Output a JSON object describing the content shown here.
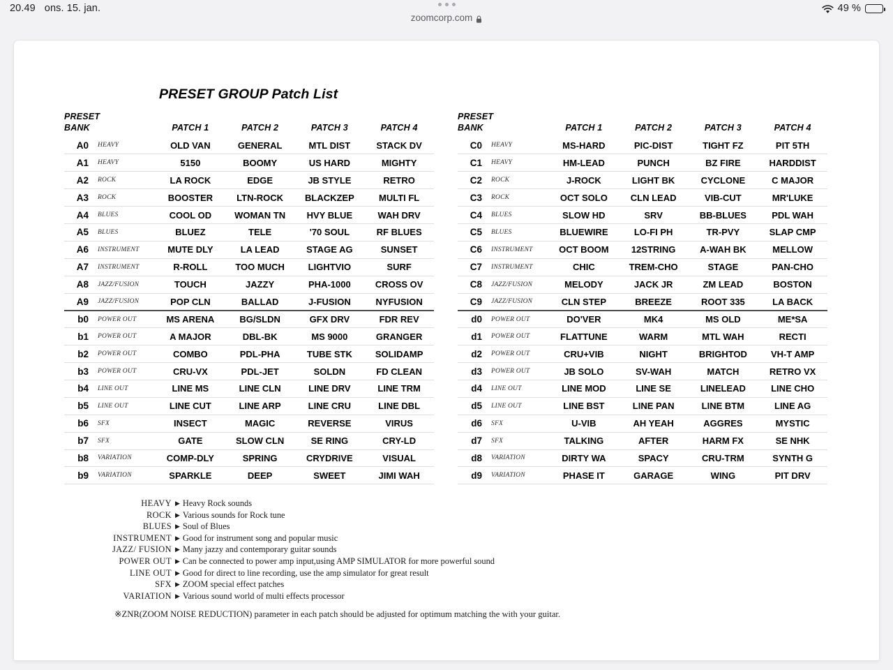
{
  "status_bar": {
    "time": "20.49",
    "date": "ons. 15. jan.",
    "battery_percent": "49 %",
    "wifi_icon": "wifi-icon",
    "battery_icon": "battery-icon",
    "battery_level": 49
  },
  "browser": {
    "url": "zoomcorp.com",
    "lock_icon": "lock-icon",
    "tabs_icon": "tab-overview-icon"
  },
  "document": {
    "title": "PRESET GROUP Patch List",
    "footnote": "※ZNR(ZOOM NOISE REDUCTION) parameter in each patch should be adjusted for optimum matching the with your guitar."
  },
  "tables": [
    {
      "id": "table-a-b",
      "header": {
        "preset": "PRESET",
        "bank": "BANK",
        "patches": [
          "PATCH 1",
          "PATCH 2",
          "PATCH 3",
          "PATCH 4"
        ]
      },
      "rows": [
        {
          "bank": "A0",
          "category": "HEAVY",
          "patches": [
            "OLD VAN",
            "GENERAL",
            "MTL DIST",
            "STACK DV"
          ]
        },
        {
          "bank": "A1",
          "category": "HEAVY",
          "patches": [
            "5150",
            "BOOMY",
            "US HARD",
            "MIGHTY"
          ]
        },
        {
          "bank": "A2",
          "category": "ROCK",
          "patches": [
            "LA ROCK",
            "EDGE",
            "JB STYLE",
            "RETRO"
          ]
        },
        {
          "bank": "A3",
          "category": "ROCK",
          "patches": [
            "BOOSTER",
            "LTN-ROCK",
            "BLACKZEP",
            "MULTI FL"
          ]
        },
        {
          "bank": "A4",
          "category": "BLUES",
          "patches": [
            "COOL OD",
            "WOMAN TN",
            "HVY BLUE",
            "WAH DRV"
          ]
        },
        {
          "bank": "A5",
          "category": "BLUES",
          "patches": [
            "BLUEZ",
            "TELE",
            "'70 SOUL",
            "RF BLUES"
          ]
        },
        {
          "bank": "A6",
          "category": "INSTRUMENT",
          "patches": [
            "MUTE DLY",
            "LA LEAD",
            "STAGE AG",
            "SUNSET"
          ]
        },
        {
          "bank": "A7",
          "category": "INSTRUMENT",
          "patches": [
            "R-ROLL",
            "TOO MUCH",
            "LIGHTVIO",
            "SURF"
          ]
        },
        {
          "bank": "A8",
          "category": "JAZZ/FUSION",
          "patches": [
            "TOUCH",
            "JAZZY",
            "PHA-1000",
            "CROSS OV"
          ]
        },
        {
          "bank": "A9",
          "category": "JAZZ/FUSION",
          "patches": [
            "POP CLN",
            "BALLAD",
            "J-FUSION",
            "NYFUSION"
          ],
          "divider": true
        },
        {
          "bank": "b0",
          "category": "POWER OUT",
          "patches": [
            "MS ARENA",
            "BG/SLDN",
            "GFX DRV",
            "FDR REV"
          ]
        },
        {
          "bank": "b1",
          "category": "POWER OUT",
          "patches": [
            "A MAJOR",
            "DBL-BK",
            "MS 9000",
            "GRANGER"
          ]
        },
        {
          "bank": "b2",
          "category": "POWER OUT",
          "patches": [
            "COMBO",
            "PDL-PHA",
            "TUBE STK",
            "SOLIDAMP"
          ]
        },
        {
          "bank": "b3",
          "category": "POWER OUT",
          "patches": [
            "CRU-VX",
            "PDL-JET",
            "SOLDN",
            "FD CLEAN"
          ]
        },
        {
          "bank": "b4",
          "category": "LINE OUT",
          "patches": [
            "LINE MS",
            "LINE CLN",
            "LINE DRV",
            "LINE TRM"
          ]
        },
        {
          "bank": "b5",
          "category": "LINE OUT",
          "patches": [
            "LINE CUT",
            "LINE ARP",
            "LINE CRU",
            "LINE DBL"
          ]
        },
        {
          "bank": "b6",
          "category": "SFX",
          "patches": [
            "INSECT",
            "MAGIC",
            "REVERSE",
            "VIRUS"
          ]
        },
        {
          "bank": "b7",
          "category": "SFX",
          "patches": [
            "GATE",
            "SLOW CLN",
            "SE RING",
            "CRY-LD"
          ]
        },
        {
          "bank": "b8",
          "category": "VARIATION",
          "patches": [
            "COMP-DLY",
            "SPRING",
            "CRYDRIVE",
            "VISUAL"
          ]
        },
        {
          "bank": "b9",
          "category": "VARIATION",
          "patches": [
            "SPARKLE",
            "DEEP",
            "SWEET",
            "JIMI WAH"
          ]
        }
      ]
    },
    {
      "id": "table-c-d",
      "header": {
        "preset": "PRESET",
        "bank": "BANK",
        "patches": [
          "PATCH 1",
          "PATCH 2",
          "PATCH 3",
          "PATCH 4"
        ]
      },
      "rows": [
        {
          "bank": "C0",
          "category": "HEAVY",
          "patches": [
            "MS-HARD",
            "PIC-DIST",
            "TIGHT FZ",
            "PIT 5TH"
          ]
        },
        {
          "bank": "C1",
          "category": "HEAVY",
          "patches": [
            "HM-LEAD",
            "PUNCH",
            "BZ FIRE",
            "HARDDIST"
          ]
        },
        {
          "bank": "C2",
          "category": "ROCK",
          "patches": [
            "J-ROCK",
            "LIGHT BK",
            "CYCLONE",
            "C MAJOR"
          ]
        },
        {
          "bank": "C3",
          "category": "ROCK",
          "patches": [
            "OCT SOLO",
            "CLN LEAD",
            "VIB-CUT",
            "MR'LUKE"
          ]
        },
        {
          "bank": "C4",
          "category": "BLUES",
          "patches": [
            "SLOW HD",
            "SRV",
            "BB-BLUES",
            "PDL WAH"
          ]
        },
        {
          "bank": "C5",
          "category": "BLUES",
          "patches": [
            "BLUEWIRE",
            "LO-FI PH",
            "TR-PVY",
            "SLAP CMP"
          ]
        },
        {
          "bank": "C6",
          "category": "INSTRUMENT",
          "patches": [
            "OCT BOOM",
            "12STRING",
            "A-WAH BK",
            "MELLOW"
          ]
        },
        {
          "bank": "C7",
          "category": "INSTRUMENT",
          "patches": [
            "CHIC",
            "TREM-CHO",
            "STAGE",
            "PAN-CHO"
          ]
        },
        {
          "bank": "C8",
          "category": "JAZZ/FUSION",
          "patches": [
            "MELODY",
            "JACK JR",
            "ZM LEAD",
            "BOSTON"
          ]
        },
        {
          "bank": "C9",
          "category": "JAZZ/FUSION",
          "patches": [
            "CLN STEP",
            "BREEZE",
            "ROOT 335",
            "LA BACK"
          ],
          "divider": true
        },
        {
          "bank": "d0",
          "category": "POWER OUT",
          "patches": [
            "DO'VER",
            "MK4",
            "MS OLD",
            "ME*SA"
          ]
        },
        {
          "bank": "d1",
          "category": "POWER OUT",
          "patches": [
            "FLATTUNE",
            "WARM",
            "MTL WAH",
            "RECTI"
          ]
        },
        {
          "bank": "d2",
          "category": "POWER OUT",
          "patches": [
            "CRU+VIB",
            "NIGHT",
            "BRIGHTOD",
            "VH-T AMP"
          ]
        },
        {
          "bank": "d3",
          "category": "POWER OUT",
          "patches": [
            "JB SOLO",
            "SV-WAH",
            "MATCH",
            "RETRO VX"
          ]
        },
        {
          "bank": "d4",
          "category": "LINE OUT",
          "patches": [
            "LINE MOD",
            "LINE SE",
            "LINELEAD",
            "LINE CHO"
          ]
        },
        {
          "bank": "d5",
          "category": "LINE OUT",
          "patches": [
            "LINE BST",
            "LINE PAN",
            "LINE BTM",
            "LINE AG"
          ]
        },
        {
          "bank": "d6",
          "category": "SFX",
          "patches": [
            "U-VIB",
            "AH YEAH",
            "AGGRES",
            "MYSTIC"
          ]
        },
        {
          "bank": "d7",
          "category": "SFX",
          "patches": [
            "TALKING",
            "AFTER",
            "HARM FX",
            "SE NHK"
          ]
        },
        {
          "bank": "d8",
          "category": "VARIATION",
          "patches": [
            "DIRTY WA",
            "SPACY",
            "CRU-TRM",
            "SYNTH G"
          ]
        },
        {
          "bank": "d9",
          "category": "VARIATION",
          "patches": [
            "PHASE IT",
            "GARAGE",
            "WING",
            "PIT DRV"
          ]
        }
      ]
    }
  ],
  "legend": [
    {
      "key": "HEAVY",
      "desc": "Heavy Rock sounds"
    },
    {
      "key": "ROCK",
      "desc": "Various sounds for Rock tune"
    },
    {
      "key": "BLUES",
      "desc": "Soul of Blues"
    },
    {
      "key": "INSTRUMENT",
      "desc": "Good for instrument song and popular music"
    },
    {
      "key": "JAZZ/ FUSION",
      "desc": "Many jazzy and contemporary guitar sounds"
    },
    {
      "key": "POWER OUT",
      "desc": "Can be connected to power amp input,using AMP SIMULATOR for more powerful sound"
    },
    {
      "key": "LINE  OUT",
      "desc": "Good for direct to line recording, use the amp simulator for great result"
    },
    {
      "key": "SFX",
      "desc": "ZOOM special effect patches"
    },
    {
      "key": "VARIATION",
      "desc": "Various sound world of multi effects processor"
    }
  ],
  "colors": {
    "page_background": "#f2f2f4",
    "card": "#ffffff",
    "rule": "#dfdfe2",
    "divider": "#4a4a4a",
    "text": "#000000"
  }
}
